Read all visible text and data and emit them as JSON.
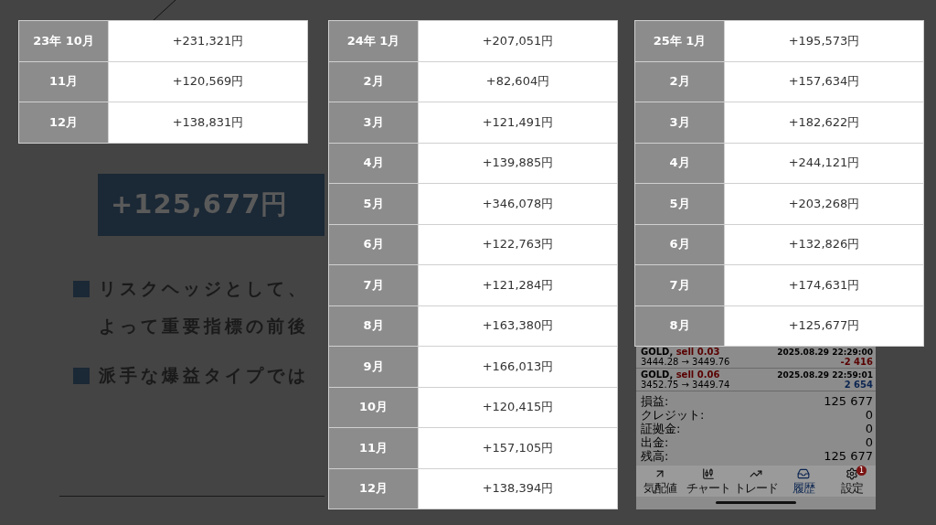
{
  "slide": {
    "amount": "+125,677円",
    "bullets": [
      {
        "lines": [
          "リスクヘッジとして、",
          "よって重要指標の前後"
        ]
      },
      {
        "lines": [
          "派手な爆益タイプでは"
        ]
      }
    ]
  },
  "phone": {
    "trades": [
      {
        "symbol": "GOLD,",
        "side": "sell 0.03",
        "time": "2025.08.29 22:29:00",
        "prices": "3444.28 → 3449.76",
        "profit": "-2 416",
        "kind": "loss"
      },
      {
        "symbol": "GOLD,",
        "side": "sell 0.06",
        "time": "2025.08.29 22:59:01",
        "prices": "3452.75 → 3449.74",
        "profit": "2 654",
        "kind": "gain"
      }
    ],
    "summary": [
      {
        "label": "損益:",
        "value": "125 677"
      },
      {
        "label": "クレジット:",
        "value": "0"
      },
      {
        "label": "証拠金:",
        "value": "0"
      },
      {
        "label": "出金:",
        "value": "0"
      },
      {
        "label": "残高:",
        "value": "125 677"
      }
    ],
    "tabs": [
      {
        "kind": "quotes",
        "label": "気配値",
        "selected": false
      },
      {
        "kind": "chart",
        "label": "チャート",
        "selected": false
      },
      {
        "kind": "trade",
        "label": "トレード",
        "selected": false
      },
      {
        "kind": "history",
        "label": "履歴",
        "selected": true
      },
      {
        "kind": "settings",
        "label": "設定",
        "selected": false,
        "badge": "1"
      }
    ]
  },
  "tables": [
    {
      "rows": [
        {
          "month": "23年 10月",
          "value": "+231,321円"
        },
        {
          "month": "11月",
          "value": "+120,569円"
        },
        {
          "month": "12月",
          "value": "+138,831円"
        }
      ]
    },
    {
      "rows": [
        {
          "month": "24年 1月",
          "value": "+207,051円"
        },
        {
          "month": "2月",
          "value": "+82,604円"
        },
        {
          "month": "3月",
          "value": "+121,491円"
        },
        {
          "month": "4月",
          "value": "+139,885円"
        },
        {
          "month": "5月",
          "value": "+346,078円"
        },
        {
          "month": "6月",
          "value": "+122,763円"
        },
        {
          "month": "7月",
          "value": "+121,284円"
        },
        {
          "month": "8月",
          "value": "+163,380円"
        },
        {
          "month": "9月",
          "value": "+166,013円"
        },
        {
          "month": "10月",
          "value": "+120,415円"
        },
        {
          "month": "11月",
          "value": "+157,105円"
        },
        {
          "month": "12月",
          "value": "+138,394円"
        }
      ]
    },
    {
      "rows": [
        {
          "month": "25年 1月",
          "value": "+195,573円"
        },
        {
          "month": "2月",
          "value": "+157,634円"
        },
        {
          "month": "3月",
          "value": "+182,622円"
        },
        {
          "month": "4月",
          "value": "+244,121円"
        },
        {
          "month": "5月",
          "value": "+203,268円"
        },
        {
          "month": "6月",
          "value": "+132,826円"
        },
        {
          "month": "7月",
          "value": "+174,631円"
        },
        {
          "month": "8月",
          "value": "+125,677円"
        }
      ]
    }
  ]
}
